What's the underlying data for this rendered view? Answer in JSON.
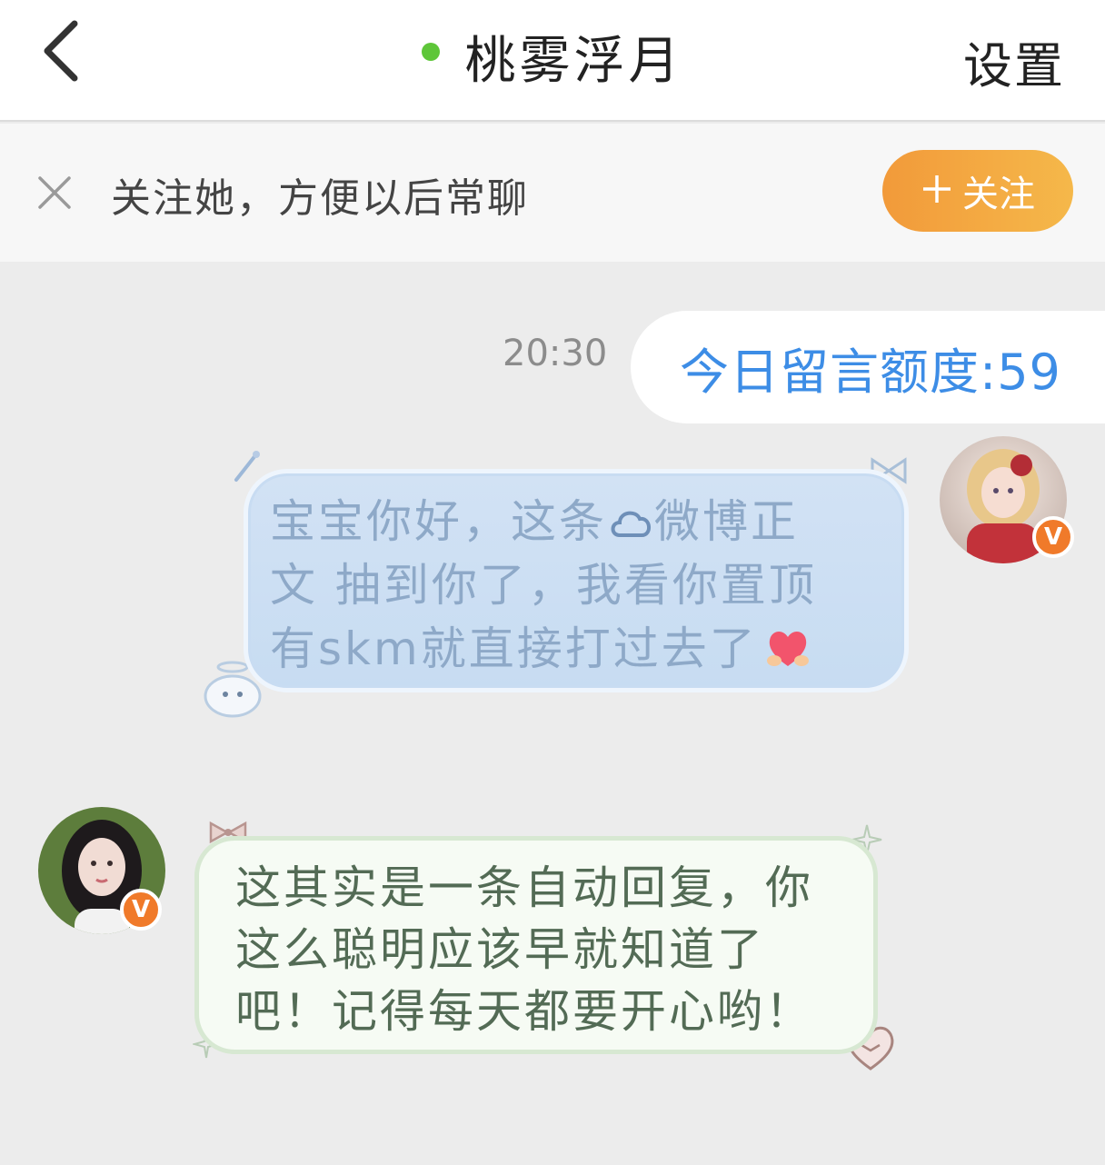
{
  "header": {
    "title": "桃雾浮月",
    "settings_label": "设置",
    "online_color": "#5ec639",
    "back_icon": "chevron-left-icon"
  },
  "follow_bar": {
    "prompt": "关注她，方便以后常聊",
    "button_label": "关注",
    "button_icon": "plus-icon",
    "close_icon": "close-icon"
  },
  "messages": [
    {
      "time": "20:30",
      "quota_text": "今日留言额度:59"
    },
    {
      "sender": "self",
      "text_line1": "宝宝你好，这条",
      "text_line1b": "微博正",
      "text_line2": "文 抽到你了，我看你置顶",
      "text_line3": "有skm就直接打过去了",
      "inline_icon": "weibo-cloud-icon",
      "emoji": "heart-hands-emoji",
      "badge": "V"
    },
    {
      "sender": "other",
      "text_line1": "这其实是一条自动回复，你",
      "text_line2": "这么聪明应该早就知道了",
      "text_line3": "吧！记得每天都要开心哟！",
      "badge": "V"
    }
  ],
  "colors": {
    "accent_blue": "#3d8de6",
    "follow_gradient_start": "#f29a3a",
    "follow_gradient_end": "#f5b84a",
    "badge_orange": "#f07a2a"
  }
}
